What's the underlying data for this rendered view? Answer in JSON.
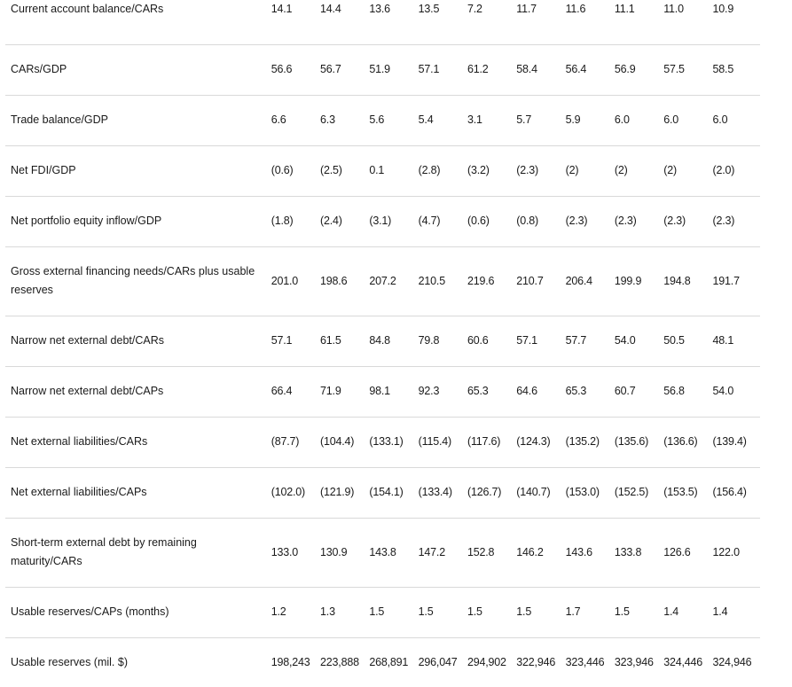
{
  "rows": [
    {
      "label": "Current account balance/CARs",
      "values": [
        "14.1",
        "14.4",
        "13.6",
        "13.5",
        "7.2",
        "11.7",
        "11.6",
        "11.1",
        "11.0",
        "10.9"
      ]
    },
    {
      "label": "CARs/GDP",
      "values": [
        "56.6",
        "56.7",
        "51.9",
        "57.1",
        "61.2",
        "58.4",
        "56.4",
        "56.9",
        "57.5",
        "58.5"
      ]
    },
    {
      "label": "Trade balance/GDP",
      "values": [
        "6.6",
        "6.3",
        "5.6",
        "5.4",
        "3.1",
        "5.7",
        "5.9",
        "6.0",
        "6.0",
        "6.0"
      ]
    },
    {
      "label": "Net FDI/GDP",
      "values": [
        "(0.6)",
        "(2.5)",
        "0.1",
        "(2.8)",
        "(3.2)",
        "(2.3)",
        "(2)",
        "(2)",
        "(2)",
        "(2.0)"
      ]
    },
    {
      "label": "Net portfolio equity inflow/GDP",
      "values": [
        "(1.8)",
        "(2.4)",
        "(3.1)",
        "(4.7)",
        "(0.6)",
        "(0.8)",
        "(2.3)",
        "(2.3)",
        "(2.3)",
        "(2.3)"
      ]
    },
    {
      "label": "Gross external financing needs/CARs plus usable reserves",
      "values": [
        "201.0",
        "198.6",
        "207.2",
        "210.5",
        "219.6",
        "210.7",
        "206.4",
        "199.9",
        "194.8",
        "191.7"
      ]
    },
    {
      "label": "Narrow net external debt/CARs",
      "values": [
        "57.1",
        "61.5",
        "84.8",
        "79.8",
        "60.6",
        "57.1",
        "57.7",
        "54.0",
        "50.5",
        "48.1"
      ]
    },
    {
      "label": "Narrow net external debt/CAPs",
      "values": [
        "66.4",
        "71.9",
        "98.1",
        "92.3",
        "65.3",
        "64.6",
        "65.3",
        "60.7",
        "56.8",
        "54.0"
      ]
    },
    {
      "label": "Net external liabilities/CARs",
      "values": [
        "(87.7)",
        "(104.4)",
        "(133.1)",
        "(115.4)",
        "(117.6)",
        "(124.3)",
        "(135.2)",
        "(135.6)",
        "(136.6)",
        "(139.4)"
      ]
    },
    {
      "label": "Net external liabilities/CAPs",
      "values": [
        "(102.0)",
        "(121.9)",
        "(154.1)",
        "(133.4)",
        "(126.7)",
        "(140.7)",
        "(153.0)",
        "(152.5)",
        "(153.5)",
        "(156.4)"
      ]
    },
    {
      "label": "Short-term external debt by remaining maturity/CARs",
      "values": [
        "133.0",
        "130.9",
        "143.8",
        "147.2",
        "152.8",
        "146.2",
        "143.6",
        "133.8",
        "126.6",
        "122.0"
      ]
    },
    {
      "label": "Usable reserves/CAPs (months)",
      "values": [
        "1.2",
        "1.3",
        "1.5",
        "1.5",
        "1.5",
        "1.5",
        "1.7",
        "1.5",
        "1.4",
        "1.4"
      ]
    },
    {
      "label": "Usable reserves (mil. $)",
      "values": [
        "198,243",
        "223,888",
        "268,891",
        "296,047",
        "294,902",
        "322,946",
        "323,446",
        "323,946",
        "324,446",
        "324,946"
      ]
    }
  ]
}
